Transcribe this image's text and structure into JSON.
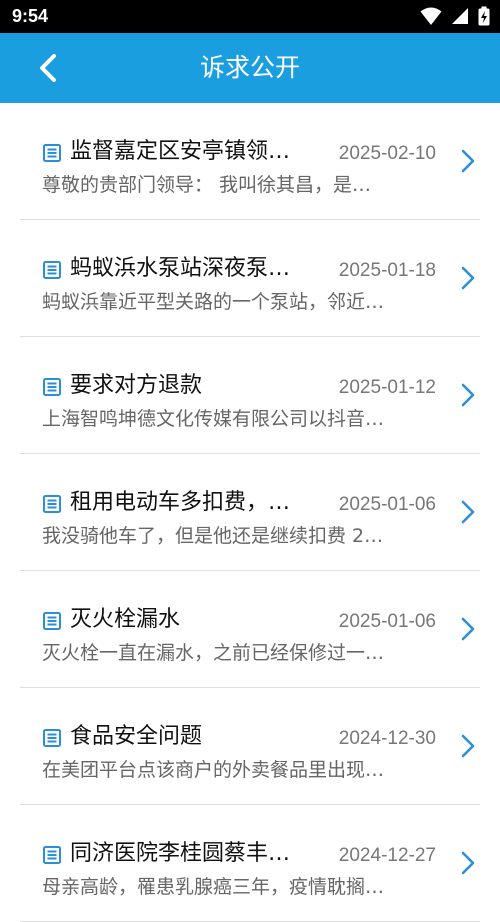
{
  "status_bar": {
    "time": "9:54",
    "icons": [
      "wifi-icon",
      "cellular-signal-icon",
      "battery-charging-icon"
    ]
  },
  "app_bar": {
    "title": "诉求公开",
    "back_icon": "chevron-left-icon",
    "color": "#1a9ee0"
  },
  "items": [
    {
      "title": "监督嘉定区安亭镇领…",
      "date": "2025-02-10",
      "summary": "尊敬的贵部门领导：   我叫徐其昌，是…"
    },
    {
      "title": "蚂蚁浜水泵站深夜泵…",
      "date": "2025-01-18",
      "summary": "蚂蚁浜靠近平型关路的一个泵站，邻近…"
    },
    {
      "title": "要求对方退款",
      "date": "2025-01-12",
      "summary": "上海智鸣坤德文化传媒有限公司以抖音…"
    },
    {
      "title": "租用电动车多扣费，…",
      "date": "2025-01-06",
      "summary": "我没骑他车了，但是他还是继续扣费 2…"
    },
    {
      "title": "灭火栓漏水",
      "date": "2025-01-06",
      "summary": "灭火栓一直在漏水，之前已经保修过一…"
    },
    {
      "title": "食品安全问题",
      "date": "2024-12-30",
      "summary": "在美团平台点该商户的外卖餐品里出现…"
    },
    {
      "title": "同济医院李桂圆蔡丰…",
      "date": "2024-12-27",
      "summary": "母亲高龄，罹患乳腺癌三年，疫情耽搁…"
    }
  ]
}
